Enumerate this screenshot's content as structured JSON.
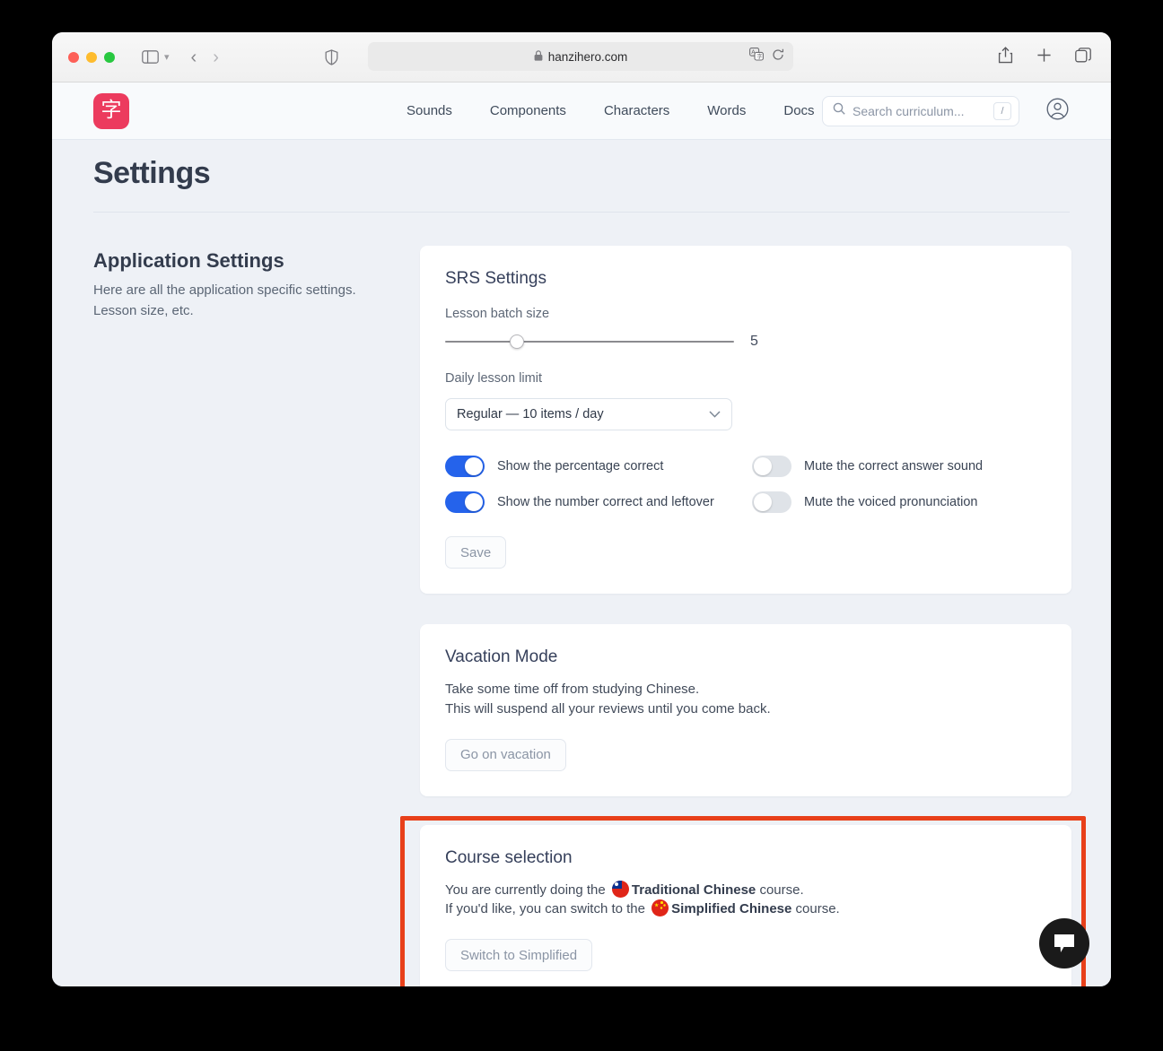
{
  "browser": {
    "url": "hanzihero.com",
    "lock_icon": "lock-icon",
    "traffic_lights": [
      "close",
      "minimize",
      "zoom"
    ],
    "sidebar_icon": "sidebar-icon",
    "back_icon": "back-chevron-icon",
    "forward_icon": "forward-chevron-icon",
    "shield_icon": "privacy-shield-icon",
    "translate_icon": "translate-icon",
    "reload_icon": "reload-icon",
    "share_icon": "share-icon",
    "new_tab_icon": "plus-icon",
    "tabs_icon": "tab-overview-icon"
  },
  "site_header": {
    "logo_glyph": "字",
    "logo_color": "#ec3b5e",
    "nav": [
      {
        "label": "Sounds"
      },
      {
        "label": "Components"
      },
      {
        "label": "Characters"
      },
      {
        "label": "Words"
      },
      {
        "label": "Docs"
      }
    ],
    "search": {
      "placeholder": "Search curriculum...",
      "shortcut": "/",
      "icon": "search-icon"
    },
    "account_icon": "account-circle-icon"
  },
  "page": {
    "title": "Settings",
    "left_column": {
      "heading": "Application Settings",
      "line1": "Here are all the application specific settings.",
      "line2": "Lesson size, etc."
    },
    "srs_card": {
      "title": "SRS Settings",
      "batch_label": "Lesson batch size",
      "batch_value": "5",
      "daily_label": "Daily lesson limit",
      "daily_value": "Regular — 10 items / day",
      "toggles": [
        {
          "label": "Show the percentage correct",
          "on": true
        },
        {
          "label": "Mute the correct answer sound",
          "on": false
        },
        {
          "label": "Show the number correct and leftover",
          "on": true
        },
        {
          "label": "Mute the voiced pronunciation",
          "on": false
        }
      ],
      "save_label": "Save"
    },
    "vacation_card": {
      "title": "Vacation Mode",
      "line1": "Take some time off from studying Chinese.",
      "line2": "This will suspend all your reviews until you come back.",
      "button_label": "Go on vacation"
    },
    "course_card": {
      "title": "Course selection",
      "current_prefix": "You are currently doing the",
      "current_course": "Traditional Chinese",
      "current_suffix": "course.",
      "switch_prefix": "If you'd like, you can switch to the",
      "switch_course": "Simplified Chinese",
      "switch_suffix": "course.",
      "button_label": "Switch to Simplified",
      "current_flag": "taiwan-flag-icon",
      "switch_flag": "china-flag-icon"
    },
    "annotation_color": "#e8401a",
    "chat_icon": "chat-bubble-icon"
  },
  "colors": {
    "accent_blue": "#2563eb",
    "brand_pink": "#ec3b5e",
    "page_bg": "#eef1f6",
    "highlight": "#e8401a"
  }
}
